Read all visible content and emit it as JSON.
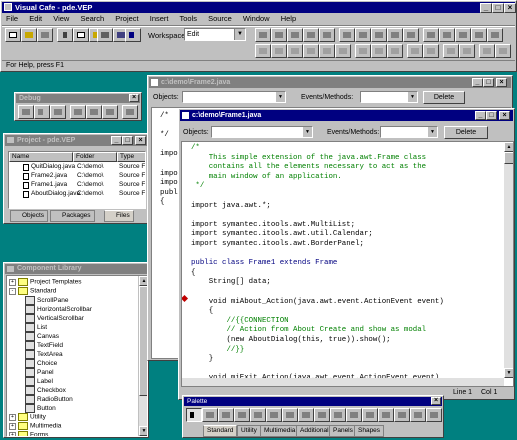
{
  "app": {
    "title": "Visual Cafe - pde.VEP",
    "menu": [
      "File",
      "Edit",
      "View",
      "Search",
      "Project",
      "Insert",
      "Tools",
      "Source",
      "Window",
      "Help"
    ],
    "workspace_label": "Workspace:",
    "workspace_value": "Edit",
    "status_text": "For Help, press F1"
  },
  "debug": {
    "title": "Debug"
  },
  "project": {
    "title": "Project - pde.VEP",
    "columns": [
      "Name",
      "Folder",
      "Type"
    ],
    "rows": [
      {
        "name": "QuitDialog.java",
        "folder": "C:\\demo\\",
        "type": "Source File"
      },
      {
        "name": "Frame2.java",
        "folder": "C:\\demo\\",
        "type": "Source File"
      },
      {
        "name": "Frame1.java",
        "folder": "C:\\demo\\",
        "type": "Source File"
      },
      {
        "name": "AboutDialog.java",
        "folder": "C:\\demo\\",
        "type": "Source File"
      }
    ],
    "tabs": [
      "Objects",
      "Packages",
      "Files"
    ]
  },
  "library": {
    "title": "Component Library",
    "items": [
      {
        "label": "Project Templates",
        "kind": "folder",
        "expander": "+",
        "indent": 0
      },
      {
        "label": "Standard",
        "kind": "folder",
        "expander": "-",
        "indent": 0
      },
      {
        "label": "ScrollPane",
        "kind": "comp",
        "indent": 1
      },
      {
        "label": "HorizontalScrollbar",
        "kind": "comp",
        "indent": 1
      },
      {
        "label": "VerticalScrollbar",
        "kind": "comp",
        "indent": 1
      },
      {
        "label": "List",
        "kind": "comp",
        "indent": 1
      },
      {
        "label": "Canvas",
        "kind": "comp",
        "indent": 1
      },
      {
        "label": "TextField",
        "kind": "comp",
        "indent": 1
      },
      {
        "label": "TextArea",
        "kind": "comp",
        "indent": 1
      },
      {
        "label": "Choice",
        "kind": "comp",
        "indent": 1
      },
      {
        "label": "Panel",
        "kind": "comp",
        "indent": 1
      },
      {
        "label": "Label",
        "kind": "comp",
        "indent": 1
      },
      {
        "label": "Checkbox",
        "kind": "comp",
        "indent": 1
      },
      {
        "label": "RadioButton",
        "kind": "comp",
        "indent": 1
      },
      {
        "label": "Button",
        "kind": "comp",
        "indent": 1
      },
      {
        "label": "Utility",
        "kind": "folder",
        "expander": "+",
        "indent": 0
      },
      {
        "label": "Multimedia",
        "kind": "folder",
        "expander": "+",
        "indent": 0
      },
      {
        "label": "Forms",
        "kind": "folder",
        "expander": "+",
        "indent": 0
      }
    ]
  },
  "frame2": {
    "title": "c:\\demo\\Frame2.java",
    "objects_label": "Objects:",
    "events_label": "Events/Methods:",
    "delete_label": "Delete",
    "code": [
      "/*",
      "",
      "*/",
      "",
      "impo",
      "",
      "impo",
      "impo",
      "publ",
      "{"
    ]
  },
  "frame1": {
    "title": "c:\\demo\\Frame1.java",
    "objects_label": "Objects:",
    "events_label": "Events/Methods:",
    "delete_label": "Delete",
    "line_label": "Line 1",
    "col_label": "Col 1",
    "code": [
      {
        "t": "/*",
        "c": "cm"
      },
      {
        "t": "    This simple extension of the java.awt.Frame class",
        "c": "cm"
      },
      {
        "t": "    contains all the elements necessary to act as the",
        "c": "cm"
      },
      {
        "t": "    main window of an application.",
        "c": "cm"
      },
      {
        "t": " */",
        "c": "cm"
      },
      {
        "t": "",
        "c": ""
      },
      {
        "t": "import java.awt.*;",
        "c": ""
      },
      {
        "t": "",
        "c": ""
      },
      {
        "t": "import symantec.itools.awt.MultiList;",
        "c": ""
      },
      {
        "t": "import symantec.itools.awt.util.Calendar;",
        "c": ""
      },
      {
        "t": "import symantec.itools.awt.BorderPanel;",
        "c": ""
      },
      {
        "t": "",
        "c": ""
      },
      {
        "t": "public class Frame1 extends Frame",
        "c": "kw"
      },
      {
        "t": "{",
        "c": ""
      },
      {
        "t": "    String[] data;",
        "c": ""
      },
      {
        "t": "",
        "c": ""
      },
      {
        "t": "    void miAbout_Action(java.awt.event.ActionEvent event)",
        "c": ""
      },
      {
        "t": "    {",
        "c": ""
      },
      {
        "t": "        //{{CONNECTION",
        "c": "cm"
      },
      {
        "t": "        // Action from About Create and show as modal",
        "c": "cm"
      },
      {
        "t": "        (new AboutDialog(this, true)).show();",
        "c": ""
      },
      {
        "t": "        //}}",
        "c": "cm"
      },
      {
        "t": "    }",
        "c": ""
      },
      {
        "t": "",
        "c": ""
      },
      {
        "t": "    void miExit_Action(java.awt.event.ActionEvent event)",
        "c": ""
      }
    ]
  },
  "palette": {
    "title": "Palette",
    "tabs": [
      "Standard",
      "Utility",
      "Multimedia",
      "Additional",
      "Panels",
      "Shapes"
    ]
  }
}
